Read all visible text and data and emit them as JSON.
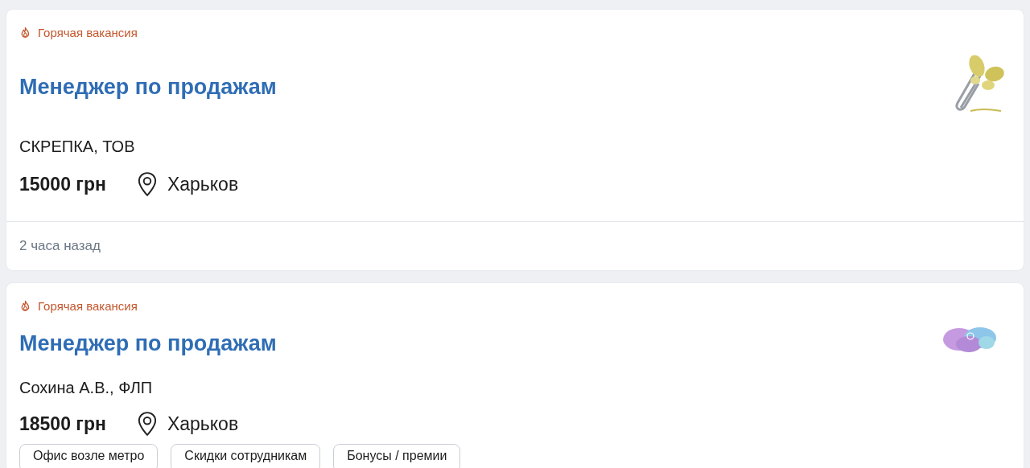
{
  "vacancies": [
    {
      "hot": true,
      "hot_label": "Горячая вакансия",
      "title": "Менеджер по продажам",
      "company": "СКРЕПКА, ТОВ",
      "salary": "15000 грн",
      "city": "Харьков",
      "logo": {
        "kind": "butterfly"
      },
      "posted": "2 часа назад"
    },
    {
      "hot": true,
      "hot_label": "Горячая вакансия",
      "title": "Менеджер по продажам",
      "company": "Сохина А.В., ФЛП",
      "salary": "18500 грн",
      "city": "Харьков",
      "logo": {
        "kind": "splash"
      },
      "tags": [
        "Офис возле метро",
        "Скидки сотрудникам",
        "Бонусы / премии"
      ]
    }
  ]
}
